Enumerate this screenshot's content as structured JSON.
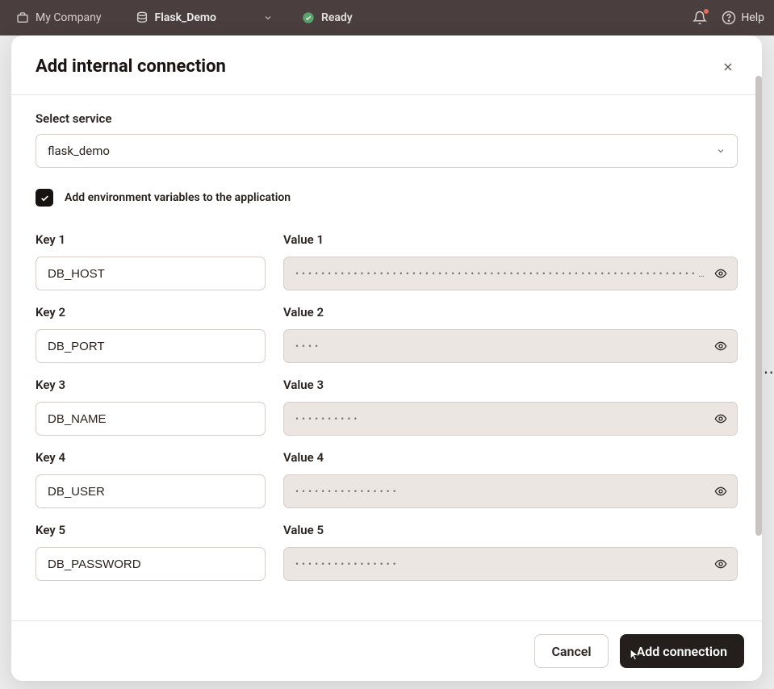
{
  "header": {
    "company": "My Company",
    "project": "Flask_Demo",
    "status": "Ready",
    "help": "Help"
  },
  "modal": {
    "title": "Add internal connection",
    "service_label": "Select service",
    "service_value": "flask_demo",
    "checkbox_label": "Add environment variables to the application",
    "checkbox_checked": true,
    "rows": [
      {
        "key_label": "Key 1",
        "key_value": "DB_HOST",
        "val_label": "Value 1",
        "val_mask": "••••••••••••••••••••••••••••••••••••••••••••••••••••••••••••••…"
      },
      {
        "key_label": "Key 2",
        "key_value": "DB_PORT",
        "val_label": "Value 2",
        "val_mask": "••••"
      },
      {
        "key_label": "Key 3",
        "key_value": "DB_NAME",
        "val_label": "Value 3",
        "val_mask": "••••••••••"
      },
      {
        "key_label": "Key 4",
        "key_value": "DB_USER",
        "val_label": "Value 4",
        "val_mask": "••••••••••••••••"
      },
      {
        "key_label": "Key 5",
        "key_value": "DB_PASSWORD",
        "val_label": "Value 5",
        "val_mask": "••••••••••••••••"
      }
    ],
    "cancel": "Cancel",
    "submit": "Add connection"
  }
}
